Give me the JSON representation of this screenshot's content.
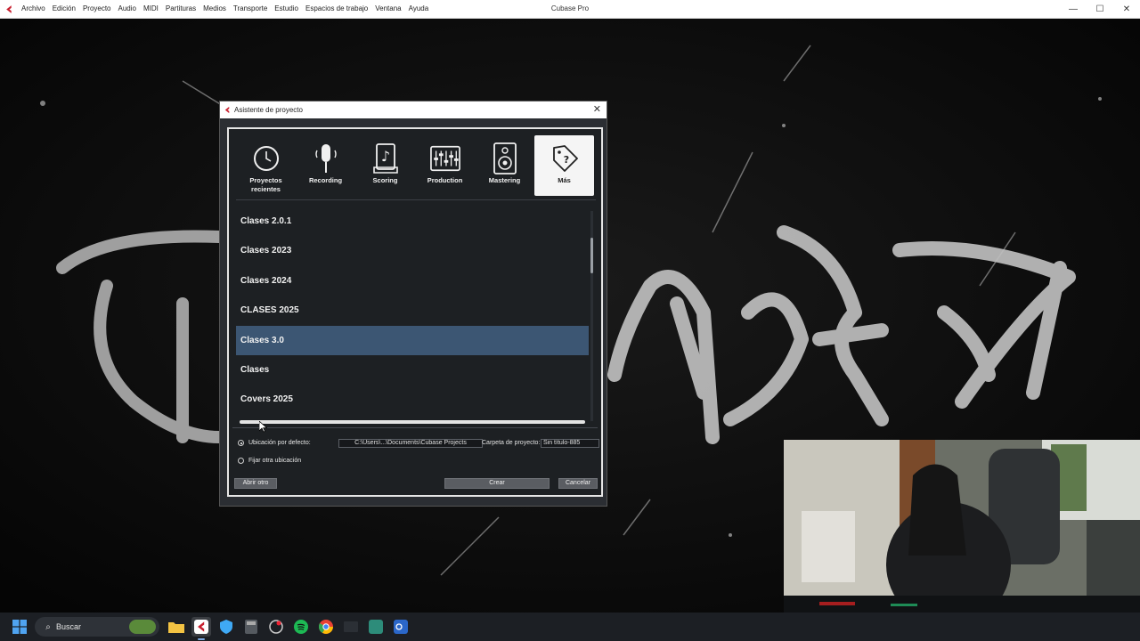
{
  "app": {
    "title": "Cubase Pro",
    "menu": [
      "Archivo",
      "Edición",
      "Proyecto",
      "Audio",
      "MIDI",
      "Partituras",
      "Medios",
      "Transporte",
      "Estudio",
      "Espacios de trabajo",
      "Ventana",
      "Ayuda"
    ],
    "window_controls": {
      "minimize": "—",
      "maximize": "☐",
      "close": "✕"
    }
  },
  "dialog": {
    "title": "Asistente de proyecto",
    "close": "✕",
    "categories": [
      {
        "label_line1": "Proyectos",
        "label_line2": "recientes",
        "icon": "clock-icon"
      },
      {
        "label_line1": "Recording",
        "label_line2": "",
        "icon": "microphone-icon"
      },
      {
        "label_line1": "Scoring",
        "label_line2": "",
        "icon": "sheet-music-icon"
      },
      {
        "label_line1": "Production",
        "label_line2": "",
        "icon": "mixer-faders-icon"
      },
      {
        "label_line1": "Mastering",
        "label_line2": "",
        "icon": "speaker-icon"
      },
      {
        "label_line1": "Más",
        "label_line2": "",
        "icon": "tag-icon"
      }
    ],
    "active_category": 5,
    "templates": [
      "Clases 2.0.1",
      "Clases 2023",
      "Clases 2024",
      "CLASES 2025",
      "Clases 3.0",
      "Clases",
      "Covers 2025"
    ],
    "selected_template": 4,
    "location": {
      "default_label": "Ubicación por defecto:",
      "default_path": "C:\\Users\\...\\Documents\\Cubase Projects",
      "folder_label": "Carpeta de proyecto:",
      "folder_value": "Sin título-885",
      "other_label": "Fijar otra ubicación"
    },
    "buttons": {
      "open_other": "Abrir otro",
      "create": "Crear",
      "cancel": "Cancelar"
    }
  },
  "taskbar": {
    "search_placeholder": "Buscar",
    "apps": [
      "file-explorer-icon",
      "cubase-icon",
      "shield-icon",
      "calculator-icon",
      "media-player-icon",
      "spotify-icon",
      "chrome-icon",
      "app-icon",
      "teams-icon",
      "outlook-icon"
    ]
  },
  "colors": {
    "selection": "#3c5673",
    "dialog_bg": "#1d2023",
    "cubase_red": "#c8202f"
  }
}
